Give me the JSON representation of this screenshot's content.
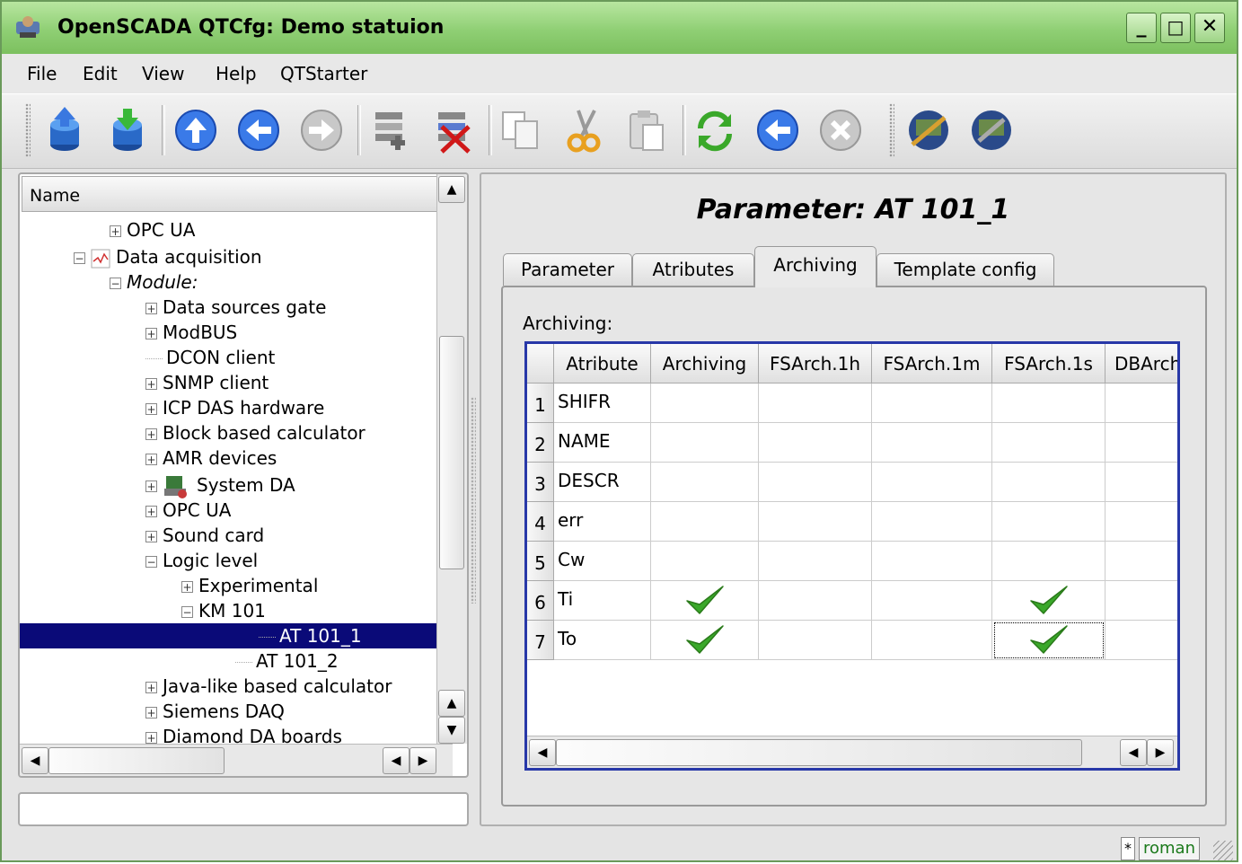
{
  "window": {
    "title": "OpenSCADA QTCfg: Demo statuion",
    "controls": {
      "minimize": "_",
      "maximize": "□",
      "close": "✕"
    }
  },
  "menu": [
    "File",
    "Edit",
    "View",
    "Help",
    "QTStarter"
  ],
  "toolbar": {
    "buttons": [
      "db-load-icon",
      "db-save-icon",
      "up-icon",
      "back-icon",
      "forward-icon",
      "add-item-icon",
      "delete-item-icon",
      "copy-icon",
      "cut-icon",
      "paste-icon",
      "refresh-icon",
      "start-icon",
      "stop-icon",
      "station-icon",
      "station-config-icon"
    ]
  },
  "tree": {
    "header": "Name",
    "items": [
      {
        "label": "OPC UA",
        "level": 2,
        "expander": "+"
      },
      {
        "label": "Data acquisition",
        "level": 1,
        "expander": "−",
        "icon": "chart"
      },
      {
        "label": "Module:",
        "level": 2,
        "expander": "−",
        "italic": true
      },
      {
        "label": "Data sources gate",
        "level": 3,
        "expander": "+"
      },
      {
        "label": "ModBUS",
        "level": 3,
        "expander": "+"
      },
      {
        "label": "DCON client",
        "level": 3,
        "expander": ""
      },
      {
        "label": "SNMP client",
        "level": 3,
        "expander": "+"
      },
      {
        "label": "ICP DAS hardware",
        "level": 3,
        "expander": "+"
      },
      {
        "label": "Block based calculator",
        "level": 3,
        "expander": "+"
      },
      {
        "label": "AMR devices",
        "level": 3,
        "expander": "+"
      },
      {
        "label": "System DA",
        "level": 3,
        "expander": "+",
        "icon": "system"
      },
      {
        "label": "OPC UA",
        "level": 3,
        "expander": "+"
      },
      {
        "label": "Sound card",
        "level": 3,
        "expander": "+"
      },
      {
        "label": "Logic level",
        "level": 3,
        "expander": "−"
      },
      {
        "label": "Experimental",
        "level": 4,
        "expander": "+"
      },
      {
        "label": "KM 101",
        "level": 4,
        "expander": "−"
      },
      {
        "label": "AT 101_1",
        "level": 5,
        "expander": "",
        "selected": true
      },
      {
        "label": "AT 101_2",
        "level": 5,
        "expander": ""
      },
      {
        "label": "Java-like based calculator",
        "level": 3,
        "expander": "+"
      },
      {
        "label": "Siemens DAQ",
        "level": 3,
        "expander": "+"
      },
      {
        "label": "Diamond DA boards",
        "level": 3,
        "expander": "+"
      }
    ]
  },
  "page": {
    "title": "Parameter: AT 101_1",
    "tabs": [
      "Parameter",
      "Atributes",
      "Archiving",
      "Template config"
    ],
    "active_tab": "Archiving",
    "section_label": "Archiving:",
    "table": {
      "columns": [
        "Atribute",
        "Archiving",
        "FSArch.1h",
        "FSArch.1m",
        "FSArch.1s",
        "DBArch"
      ],
      "rows": [
        {
          "num": "1",
          "atribute": "SHIFR",
          "checks": [
            false,
            false,
            false,
            false,
            false
          ]
        },
        {
          "num": "2",
          "atribute": "NAME",
          "checks": [
            false,
            false,
            false,
            false,
            false
          ]
        },
        {
          "num": "3",
          "atribute": "DESCR",
          "checks": [
            false,
            false,
            false,
            false,
            false
          ]
        },
        {
          "num": "4",
          "atribute": "err",
          "checks": [
            false,
            false,
            false,
            false,
            false
          ]
        },
        {
          "num": "5",
          "atribute": "Cw",
          "checks": [
            false,
            false,
            false,
            false,
            false
          ]
        },
        {
          "num": "6",
          "atribute": "Ti",
          "checks": [
            true,
            false,
            false,
            true,
            false
          ]
        },
        {
          "num": "7",
          "atribute": "To",
          "checks": [
            true,
            false,
            false,
            true,
            false
          ]
        }
      ]
    }
  },
  "status": {
    "modified": "*",
    "user": "roman"
  },
  "colors": {
    "title_bar": "#8fcf74",
    "selection": "#0a0a78",
    "grid_border": "#2838a8",
    "check": "#3aa82a",
    "user_text": "#1c7a1c"
  }
}
